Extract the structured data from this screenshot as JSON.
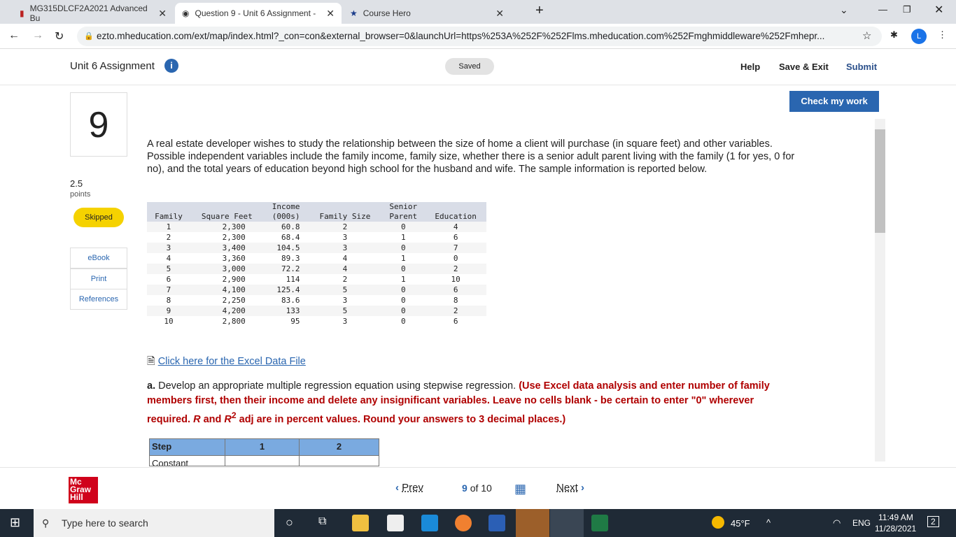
{
  "browser": {
    "tabs": [
      {
        "title": "MG315DLCF2A2021 Advanced Bu"
      },
      {
        "title": "Question 9 - Unit 6 Assignment -"
      },
      {
        "title": "Course Hero"
      }
    ],
    "url": "ezto.mheducation.com/ext/map/index.html?_con=con&external_browser=0&launchUrl=https%253A%252F%252Flms.mheducation.com%252Fmghmiddleware%252Fmhepr...",
    "profile": "L"
  },
  "header": {
    "title": "Unit 6 Assignment",
    "saved": "Saved",
    "help": "Help",
    "save_exit": "Save & Exit",
    "submit": "Submit",
    "check": "Check my work"
  },
  "question": {
    "number": "9",
    "points": "2.5",
    "points_label": "points",
    "status": "Skipped",
    "text": "A real estate developer wishes to study the relationship between the size of home a client will purchase (in square feet) and other variables. Possible independent variables include the family income, family size, whether there is a senior adult parent living with the family (1 for yes, 0 for no), and the total years of education beyond high school for the husband and wife. The sample information is reported below.",
    "excel_link": "Click here for the Excel Data File",
    "part_a_label": "a.",
    "part_a": "Develop an appropriate multiple regression equation using stepwise regression.",
    "part_a_instr1": "(Use Excel data analysis and enter number of family members first, then their income and delete any insignificant variables. Leave no cells blank - be certain to enter \"0\" wherever required.",
    "part_a_R": "R",
    "part_a_and": "and",
    "part_a_R2": "R",
    "part_a_sup": "2",
    "part_a_instr2": "adj are in percent values. Round your answers to 3 decimal places.)"
  },
  "side": {
    "ebook": "eBook",
    "print": "Print",
    "references": "References"
  },
  "table": {
    "headers": [
      [
        "",
        "Family"
      ],
      [
        "",
        "Square Feet"
      ],
      [
        "Income",
        "(000s)"
      ],
      [
        "",
        "Family Size"
      ],
      [
        "Senior",
        "Parent"
      ],
      [
        "",
        "Education"
      ]
    ],
    "rows": [
      [
        "1",
        "2,300",
        "60.8",
        "2",
        "0",
        "4"
      ],
      [
        "2",
        "2,300",
        "68.4",
        "3",
        "1",
        "6"
      ],
      [
        "3",
        "3,400",
        "104.5",
        "3",
        "0",
        "7"
      ],
      [
        "4",
        "3,360",
        "89.3",
        "4",
        "1",
        "0"
      ],
      [
        "5",
        "3,000",
        "72.2",
        "4",
        "0",
        "2"
      ],
      [
        "6",
        "2,900",
        "114",
        "2",
        "1",
        "10"
      ],
      [
        "7",
        "4,100",
        "125.4",
        "5",
        "0",
        "6"
      ],
      [
        "8",
        "2,250",
        "83.6",
        "3",
        "0",
        "8"
      ],
      [
        "9",
        "4,200",
        "133",
        "5",
        "0",
        "2"
      ],
      [
        "10",
        "2,800",
        "95",
        "3",
        "0",
        "6"
      ]
    ]
  },
  "answer": {
    "step": "Step",
    "c1": "1",
    "c2": "2",
    "constant": "Constant"
  },
  "footer": {
    "prev": "Prev",
    "current": "9",
    "of": "of 10",
    "next": "Next",
    "logo": "Mc Graw Hill"
  },
  "taskbar": {
    "search": "Type here to search",
    "temp": "45°F",
    "lang": "ENG",
    "time": "11:49 AM",
    "date": "11/28/2021",
    "notif": "2"
  }
}
